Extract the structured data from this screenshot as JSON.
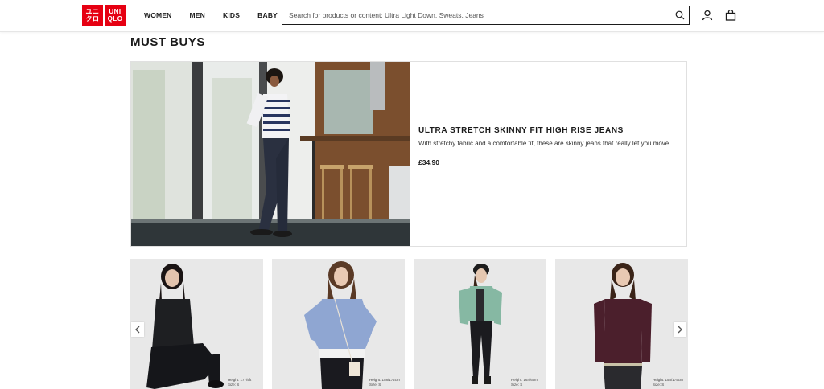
{
  "header": {
    "logo": {
      "top_left": "ユニ",
      "top_right": "UNI",
      "bottom_left": "クロ",
      "bottom_right": "QLO"
    },
    "nav": [
      {
        "label": "WOMEN"
      },
      {
        "label": "MEN"
      },
      {
        "label": "KIDS"
      },
      {
        "label": "BABY"
      }
    ],
    "search": {
      "placeholder": "Search for products or content: Ultra Light Down, Sweats, Jeans",
      "value": ""
    },
    "icons": [
      "search-icon",
      "account-icon",
      "bag-icon"
    ]
  },
  "section": {
    "title": "MUST BUYS"
  },
  "hero": {
    "name": "ULTRA STRETCH SKINNY FIT HIGH RISE JEANS",
    "description": "With stretchy fabric and a comfortable fit, these are skinny jeans that really let you move.",
    "price": "£34.90"
  },
  "products": [
    {
      "model_height": "Height: 177/5ft",
      "model_size": "Size: S",
      "colors": {
        "top": "#1e1f22",
        "bottom": "#15161a",
        "hair": "#1a1414"
      }
    },
    {
      "model_height": "Height: 158/172cm",
      "model_size": "Size: S",
      "colors": {
        "top": "#8fa6d2",
        "bottom": "#1a1a1f",
        "hair": "#5a3a26"
      }
    },
    {
      "model_height": "Height: 164/6cm",
      "model_size": "Size: S",
      "colors": {
        "top": "#86b8a3",
        "bottom": "#1b1b1f",
        "hair": "#1c1c1c"
      }
    },
    {
      "model_height": "Height: 158/175cm",
      "model_size": "Size: S",
      "colors": {
        "top": "#4b1f2c",
        "bottom": "#2a2a2e",
        "hair": "#3a2418"
      }
    }
  ],
  "carousel": {
    "prev_icon": "chevron-left-icon",
    "next_icon": "chevron-right-icon"
  },
  "colors": {
    "brand_red": "#e60012",
    "text": "#1b1b1b"
  }
}
